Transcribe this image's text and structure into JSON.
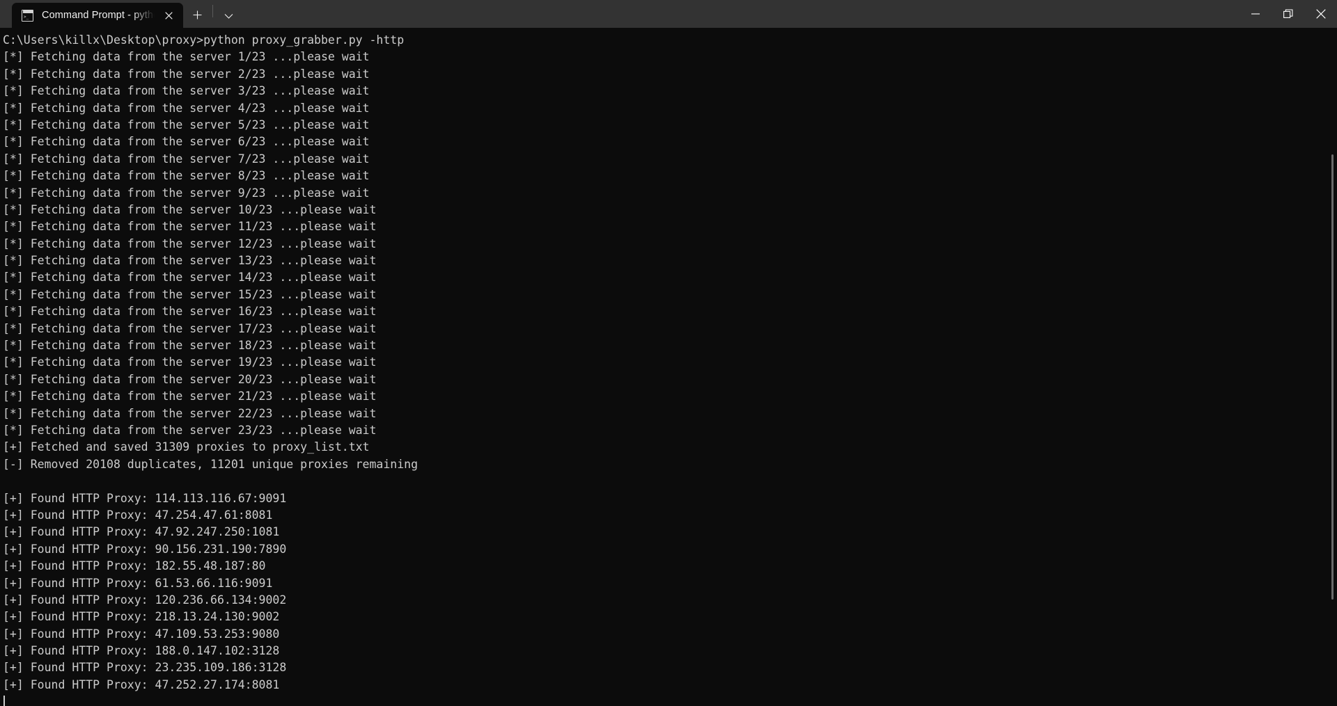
{
  "window": {
    "titlebar_bg": "#333333",
    "terminal_bg": "#0c0c0c",
    "terminal_fg": "#cccccc",
    "tab": {
      "title": "Command Prompt - python p",
      "icon": "command-prompt-icon",
      "close_icon": "close-icon"
    },
    "tabstrip": {
      "new_tab_label": "+",
      "new_tab_icon": "plus-icon",
      "dropdown_icon": "chevron-down-icon"
    },
    "controls": {
      "minimize_icon": "minimize-icon",
      "maximize_icon": "restore-icon",
      "close_icon": "close-icon"
    }
  },
  "terminal": {
    "prompt_line": "C:\\Users\\killx\\Desktop\\proxy>python proxy_grabber.py -http",
    "lines": [
      "C:\\Users\\killx\\Desktop\\proxy>python proxy_grabber.py -http",
      "[*] Fetching data from the server 1/23 ...please wait",
      "[*] Fetching data from the server 2/23 ...please wait",
      "[*] Fetching data from the server 3/23 ...please wait",
      "[*] Fetching data from the server 4/23 ...please wait",
      "[*] Fetching data from the server 5/23 ...please wait",
      "[*] Fetching data from the server 6/23 ...please wait",
      "[*] Fetching data from the server 7/23 ...please wait",
      "[*] Fetching data from the server 8/23 ...please wait",
      "[*] Fetching data from the server 9/23 ...please wait",
      "[*] Fetching data from the server 10/23 ...please wait",
      "[*] Fetching data from the server 11/23 ...please wait",
      "[*] Fetching data from the server 12/23 ...please wait",
      "[*] Fetching data from the server 13/23 ...please wait",
      "[*] Fetching data from the server 14/23 ...please wait",
      "[*] Fetching data from the server 15/23 ...please wait",
      "[*] Fetching data from the server 16/23 ...please wait",
      "[*] Fetching data from the server 17/23 ...please wait",
      "[*] Fetching data from the server 18/23 ...please wait",
      "[*] Fetching data from the server 19/23 ...please wait",
      "[*] Fetching data from the server 20/23 ...please wait",
      "[*] Fetching data from the server 21/23 ...please wait",
      "[*] Fetching data from the server 22/23 ...please wait",
      "[*] Fetching data from the server 23/23 ...please wait",
      "[+] Fetched and saved 31309 proxies to proxy_list.txt",
      "[-] Removed 20108 duplicates, 11201 unique proxies remaining",
      "",
      "[+] Found HTTP Proxy: 114.113.116.67:9091",
      "[+] Found HTTP Proxy: 47.254.47.61:8081",
      "[+] Found HTTP Proxy: 47.92.247.250:1081",
      "[+] Found HTTP Proxy: 90.156.231.190:7890",
      "[+] Found HTTP Proxy: 182.55.48.187:80",
      "[+] Found HTTP Proxy: 61.53.66.116:9091",
      "[+] Found HTTP Proxy: 120.236.66.134:9002",
      "[+] Found HTTP Proxy: 218.13.24.130:9002",
      "[+] Found HTTP Proxy: 47.109.53.253:9080",
      "[+] Found HTTP Proxy: 188.0.147.102:3128",
      "[+] Found HTTP Proxy: 23.235.109.186:3128",
      "[+] Found HTTP Proxy: 47.252.27.174:8081"
    ],
    "summary": {
      "fetched_count": "31309",
      "output_file": "proxy_list.txt",
      "duplicates_removed": "20108",
      "unique_remaining": "11201",
      "server_total": "23"
    }
  }
}
